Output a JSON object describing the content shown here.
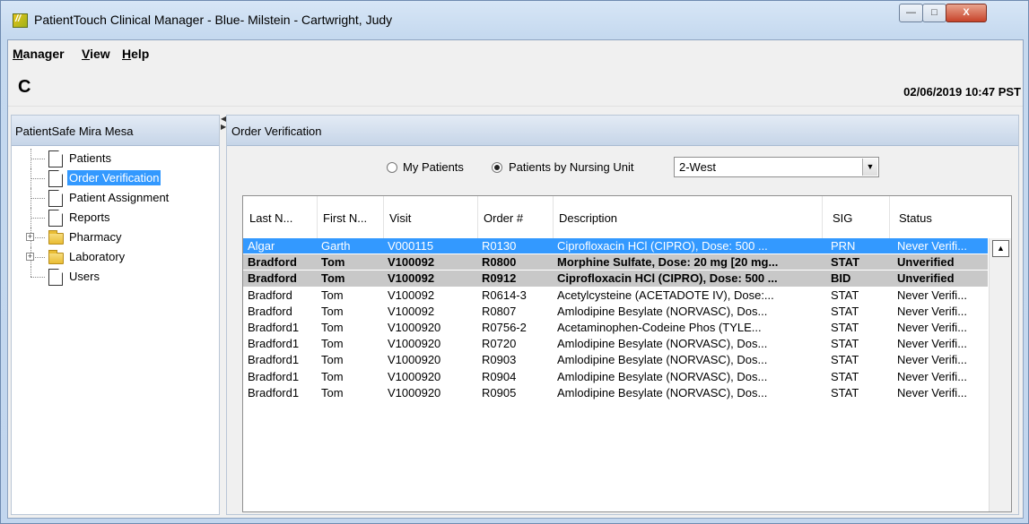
{
  "window": {
    "title": "PatientTouch Clinical Manager - Blue- Milstein - Cartwright, Judy",
    "minimize_glyph": "—",
    "maximize_glyph": "□",
    "close_glyph": "X"
  },
  "menu": {
    "manager": {
      "u": "M",
      "rest": "anager"
    },
    "view": {
      "u": "V",
      "rest": "iew"
    },
    "help": {
      "u": "H",
      "rest": "elp"
    }
  },
  "toolbar": {
    "refresh_glyph": "C",
    "datetime": "02/06/2019 10:47 PST"
  },
  "sidebar": {
    "header": "PatientSafe Mira Mesa",
    "items": [
      {
        "label": "Patients",
        "icon": "document-icon",
        "selected": false
      },
      {
        "label": "Order Verification",
        "icon": "document-icon",
        "selected": true
      },
      {
        "label": "Patient Assignment",
        "icon": "document-icon",
        "selected": false
      },
      {
        "label": "Reports",
        "icon": "document-icon",
        "selected": false
      },
      {
        "label": "Pharmacy",
        "icon": "folder-icon",
        "expandable": true
      },
      {
        "label": "Laboratory",
        "icon": "folder-icon",
        "expandable": true
      },
      {
        "label": "Users",
        "icon": "document-icon",
        "selected": false
      }
    ],
    "expander_glyph": "+"
  },
  "main": {
    "header": "Order Verification",
    "filter": {
      "my_patients_label": "My Patients",
      "by_unit_label": "Patients by Nursing Unit",
      "selected_option": "Patients by Nursing Unit",
      "unit_value": "2-West",
      "dropdown_glyph": "▼"
    },
    "table": {
      "columns": [
        "Last N...",
        "First N...",
        "Visit",
        "Order #",
        "Description",
        "SIG",
        "Status"
      ],
      "rows": [
        {
          "last": "Algar",
          "first": "Garth",
          "visit": "V000115",
          "order": "R0130",
          "description": "Ciprofloxacin HCl (CIPRO), Dose: 500 ...",
          "sig": "PRN",
          "status": "Never Verifi...",
          "style": "selected"
        },
        {
          "last": "Bradford",
          "first": "Tom",
          "visit": "V100092",
          "order": "R0800",
          "description": "Morphine Sulfate, Dose: 20 mg [20 mg...",
          "sig": "STAT",
          "status": "Unverified",
          "style": "grey"
        },
        {
          "last": "Bradford",
          "first": "Tom",
          "visit": "V100092",
          "order": "R0912",
          "description": "Ciprofloxacin HCl (CIPRO), Dose: 500 ...",
          "sig": "BID",
          "status": "Unverified",
          "style": "grey"
        },
        {
          "last": "Bradford",
          "first": "Tom",
          "visit": "V100092",
          "order": "R0614-3",
          "description": "Acetylcysteine (ACETADOTE IV), Dose:...",
          "sig": "STAT",
          "status": "Never Verifi...",
          "style": "normal"
        },
        {
          "last": "Bradford",
          "first": "Tom",
          "visit": "V100092",
          "order": "R0807",
          "description": "Amlodipine Besylate (NORVASC), Dos...",
          "sig": "STAT",
          "status": "Never Verifi...",
          "style": "normal"
        },
        {
          "last": "Bradford1",
          "first": "Tom",
          "visit": "V1000920",
          "order": "R0756-2",
          "description": "Acetaminophen-Codeine Phos (TYLE...",
          "sig": "STAT",
          "status": "Never Verifi...",
          "style": "normal"
        },
        {
          "last": "Bradford1",
          "first": "Tom",
          "visit": "V1000920",
          "order": "R0720",
          "description": "Amlodipine Besylate (NORVASC), Dos...",
          "sig": "STAT",
          "status": "Never Verifi...",
          "style": "normal"
        },
        {
          "last": "Bradford1",
          "first": "Tom",
          "visit": "V1000920",
          "order": "R0903",
          "description": "Amlodipine Besylate (NORVASC), Dos...",
          "sig": "STAT",
          "status": "Never Verifi...",
          "style": "normal"
        },
        {
          "last": "Bradford1",
          "first": "Tom",
          "visit": "V1000920",
          "order": "R0904",
          "description": "Amlodipine Besylate (NORVASC), Dos...",
          "sig": "STAT",
          "status": "Never Verifi...",
          "style": "normal"
        },
        {
          "last": "Bradford1",
          "first": "Tom",
          "visit": "V1000920",
          "order": "R0905",
          "description": "Amlodipine Besylate (NORVASC), Dos...",
          "sig": "STAT",
          "status": "Never Verifi...",
          "style": "normal"
        }
      ],
      "scroll_up_glyph": "▲"
    }
  },
  "colors": {
    "selection": "#3399ff",
    "header_gradient_top": "#e3ebf5",
    "header_gradient_bottom": "#c6d5e8",
    "grey_row": "#c8c8c8"
  }
}
